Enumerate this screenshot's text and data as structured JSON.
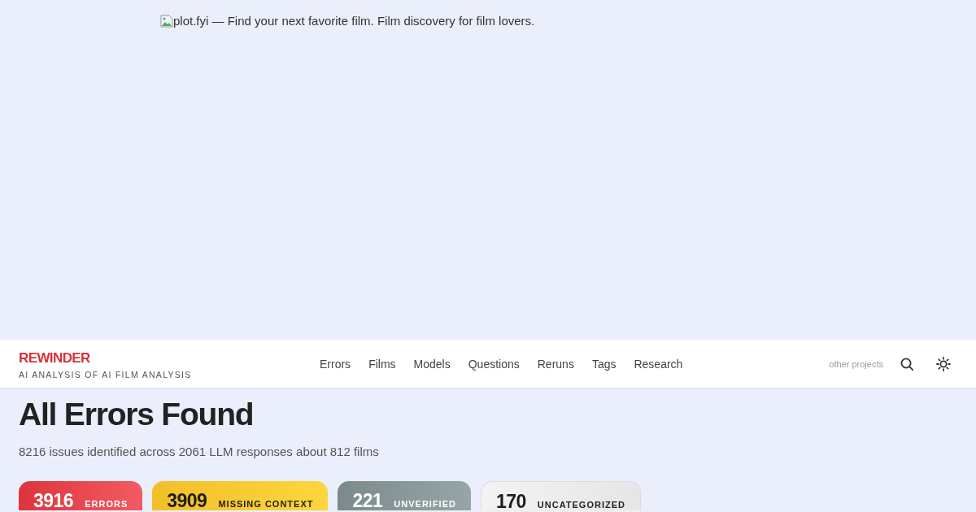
{
  "banner": {
    "alt_text": "plot.fyi — Find your next favorite film. Film discovery for film lovers."
  },
  "header": {
    "logo": "REWINDER",
    "tagline": "AI ANALYSIS OF AI FILM ANALYSIS",
    "nav": [
      {
        "label": "Errors"
      },
      {
        "label": "Films"
      },
      {
        "label": "Models"
      },
      {
        "label": "Questions"
      },
      {
        "label": "Reruns"
      },
      {
        "label": "Tags"
      },
      {
        "label": "Research"
      }
    ],
    "other_projects": "other projects"
  },
  "page": {
    "title": "All Errors Found",
    "summary": "8216 issues identified across 2061 LLM responses about 812 films"
  },
  "stats": [
    {
      "kind": "errors",
      "count": "3916",
      "label": "ERRORS"
    },
    {
      "kind": "missing",
      "count": "3909",
      "label": "MISSING CONTEXT"
    },
    {
      "kind": "unverified",
      "count": "221",
      "label": "UNVERIFIED"
    },
    {
      "kind": "uncategorized",
      "count": "170",
      "label": "UNCATEGORIZED"
    }
  ]
}
